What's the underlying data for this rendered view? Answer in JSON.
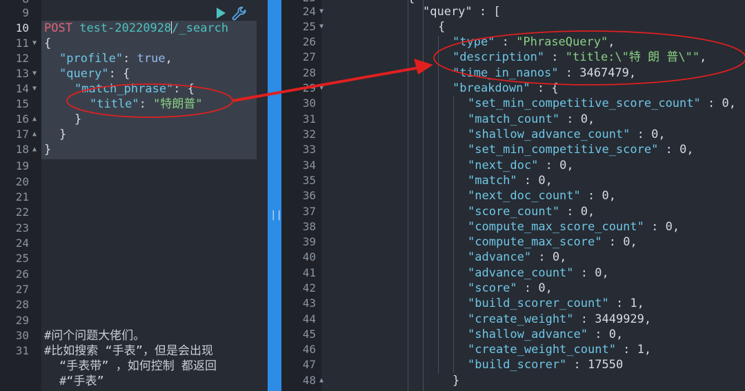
{
  "request_editor": {
    "top_partial_line": "8",
    "lines": [
      {
        "n": "9"
      },
      {
        "n": "10",
        "method": "POST",
        "url_a": "test-20220928",
        "url_b": "/_search"
      },
      {
        "n": "11",
        "text": "{"
      },
      {
        "n": "12",
        "key": "\"profile\"",
        "sep": ": ",
        "val": "true",
        "end": ","
      },
      {
        "n": "13",
        "key": "\"query\"",
        "sep": ": ",
        "end": "{"
      },
      {
        "n": "14",
        "key": "\"match_phrase\"",
        "sep": ": ",
        "end": "{"
      },
      {
        "n": "15",
        "key": "\"title\"",
        "sep": ": ",
        "val": "\"特朗普\""
      },
      {
        "n": "16",
        "text": "}"
      },
      {
        "n": "17",
        "text": "}"
      },
      {
        "n": "18",
        "text": "}"
      },
      {
        "n": "19"
      },
      {
        "n": "20"
      },
      {
        "n": "21"
      },
      {
        "n": "22"
      },
      {
        "n": "23"
      },
      {
        "n": "24"
      },
      {
        "n": "25"
      },
      {
        "n": "26"
      },
      {
        "n": "27"
      },
      {
        "n": "28"
      },
      {
        "n": "29"
      },
      {
        "n": "30",
        "comment": "#问个问题大佬们。"
      },
      {
        "n": "31",
        "comment": "#比如搜索 “手表”，但是会出现"
      }
    ],
    "comment_wrap_1": "“手表带” ，如何控制 都返回",
    "comment_wrap_2": "#“手表”"
  },
  "response_viewer": {
    "lines": [
      {
        "n": "24",
        "text": "\"query\" : ["
      },
      {
        "n": "25",
        "text": "{"
      },
      {
        "n": "26",
        "key": "\"type\"",
        "val": "\"PhraseQuery\"",
        "end": ","
      },
      {
        "n": "27",
        "key": "\"description\"",
        "val": "\"title:\\\"特 朗 普\\\"\"",
        "end": ","
      },
      {
        "n": "28",
        "key": "\"time_in_nanos\"",
        "val": "3467479",
        "end": ","
      },
      {
        "n": "29",
        "key": "\"breakdown\"",
        "end": "{"
      },
      {
        "n": "30",
        "key": "\"set_min_competitive_score_count\"",
        "val": "0",
        "end": ","
      },
      {
        "n": "31",
        "key": "\"match_count\"",
        "val": "0",
        "end": ","
      },
      {
        "n": "32",
        "key": "\"shallow_advance_count\"",
        "val": "0",
        "end": ","
      },
      {
        "n": "33",
        "key": "\"set_min_competitive_score\"",
        "val": "0",
        "end": ","
      },
      {
        "n": "34",
        "key": "\"next_doc\"",
        "val": "0",
        "end": ","
      },
      {
        "n": "35",
        "key": "\"match\"",
        "val": "0",
        "end": ","
      },
      {
        "n": "36",
        "key": "\"next_doc_count\"",
        "val": "0",
        "end": ","
      },
      {
        "n": "37",
        "key": "\"score_count\"",
        "val": "0",
        "end": ","
      },
      {
        "n": "38",
        "key": "\"compute_max_score_count\"",
        "val": "0",
        "end": ","
      },
      {
        "n": "39",
        "key": "\"compute_max_score\"",
        "val": "0",
        "end": ","
      },
      {
        "n": "40",
        "key": "\"advance\"",
        "val": "0",
        "end": ","
      },
      {
        "n": "41",
        "key": "\"advance_count\"",
        "val": "0",
        "end": ","
      },
      {
        "n": "42",
        "key": "\"score\"",
        "val": "0",
        "end": ","
      },
      {
        "n": "43",
        "key": "\"build_scorer_count\"",
        "val": "1",
        "end": ","
      },
      {
        "n": "44",
        "key": "\"create_weight\"",
        "val": "3449929",
        "end": ","
      },
      {
        "n": "45",
        "key": "\"shallow_advance\"",
        "val": "0",
        "end": ","
      },
      {
        "n": "46",
        "key": "\"create_weight_count\"",
        "val": "1",
        "end": ","
      },
      {
        "n": "47",
        "key": "\"build_scorer\"",
        "val": "17550",
        "end": ""
      },
      {
        "n": "48",
        "text": "}"
      }
    ]
  },
  "toolbar": {
    "run_icon": "play-icon",
    "settings_icon": "wrench-icon"
  },
  "divider": {
    "grip": "||"
  },
  "colors": {
    "accent_divider": "#2d8ce6",
    "annotation_red": "#e02020",
    "play_green": "#4cc2c0"
  }
}
